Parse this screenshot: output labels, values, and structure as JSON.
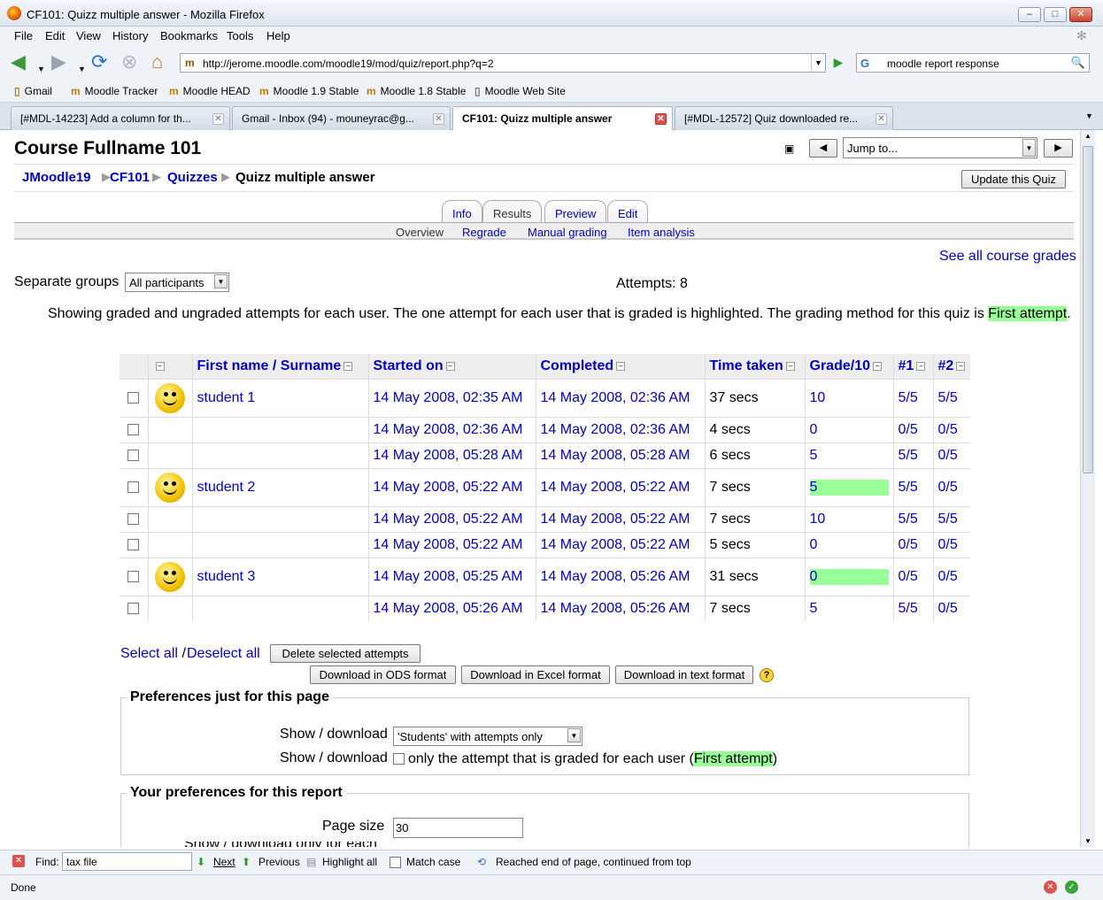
{
  "window": {
    "title": "CF101: Quizz multiple answer - Mozilla Firefox",
    "controls": [
      "minimize-icon",
      "maximize-icon",
      "close-icon"
    ]
  },
  "menu": [
    "File",
    "Edit",
    "View",
    "History",
    "Bookmarks",
    "Tools",
    "Help"
  ],
  "nav": {
    "url": "http://jerome.moodle.com/moodle19/mod/quiz/report.php?q=2",
    "search_value": "moodle report response"
  },
  "bookmarks": [
    "Gmail",
    "Moodle Tracker",
    "Moodle HEAD",
    "Moodle 1.9 Stable",
    "Moodle 1.8 Stable",
    "Moodle Web Site"
  ],
  "tabs": [
    {
      "label": "[#MDL-14223] Add a column for th..."
    },
    {
      "label": "Gmail - Inbox (94) - mouneyrac@g..."
    },
    {
      "label": "CF101: Quizz multiple answer"
    },
    {
      "label": "[#MDL-12572] Quiz downloaded re..."
    }
  ],
  "page": {
    "course_title": "Course Fullname 101",
    "jump_to": "Jump to...",
    "breadcrumb": [
      "JMoodle19",
      "CF101",
      "Quizzes",
      "Quizz multiple answer"
    ],
    "breadcrumb_sep": "▶",
    "update_button": "Update this Quiz",
    "quiz_tabs": [
      "Info",
      "Results",
      "Preview",
      "Edit"
    ],
    "sub_tabs": [
      "Overview",
      "Regrade",
      "Manual grading",
      "Item analysis"
    ],
    "see_all": "See all course grades",
    "groups_label": "Separate groups",
    "groups_value": "All participants",
    "attempts": "Attempts: 8",
    "info_text": "Showing graded and ungraded attempts for each user. The one attempt for each user that is graded is highlighted. The grading method for this quiz is",
    "info_method": "First attempt",
    "info_end": "."
  },
  "table": {
    "headers": {
      "name1": "First name",
      "slash": " / ",
      "name2": "Surname",
      "started": "Started on",
      "completed": "Completed",
      "time": "Time taken",
      "grade": "Grade/10",
      "q1": "#1",
      "q2": "#2"
    },
    "rows": [
      {
        "user": "student 1",
        "started": "14 May 2008, 02:35 AM",
        "completed": "14 May 2008, 02:36 AM",
        "time": "37 secs",
        "grade": "10",
        "q1": "5/5",
        "q2": "5/5",
        "highlight": false
      },
      {
        "user": "",
        "started": "14 May 2008, 02:36 AM",
        "completed": "14 May 2008, 02:36 AM",
        "time": "4 secs",
        "grade": "0",
        "q1": "0/5",
        "q2": "0/5",
        "highlight": false
      },
      {
        "user": "",
        "started": "14 May 2008, 05:28 AM",
        "completed": "14 May 2008, 05:28 AM",
        "time": "6 secs",
        "grade": "5",
        "q1": "5/5",
        "q2": "0/5",
        "highlight": false
      },
      {
        "user": "student 2",
        "started": "14 May 2008, 05:22 AM",
        "completed": "14 May 2008, 05:22 AM",
        "time": "7 secs",
        "grade": "5",
        "q1": "5/5",
        "q2": "0/5",
        "highlight": true
      },
      {
        "user": "",
        "started": "14 May 2008, 05:22 AM",
        "completed": "14 May 2008, 05:22 AM",
        "time": "7 secs",
        "grade": "10",
        "q1": "5/5",
        "q2": "5/5",
        "highlight": false
      },
      {
        "user": "",
        "started": "14 May 2008, 05:22 AM",
        "completed": "14 May 2008, 05:22 AM",
        "time": "5 secs",
        "grade": "0",
        "q1": "0/5",
        "q2": "0/5",
        "highlight": false
      },
      {
        "user": "student 3",
        "started": "14 May 2008, 05:25 AM",
        "completed": "14 May 2008, 05:26 AM",
        "time": "31 secs",
        "grade": "0",
        "q1": "0/5",
        "q2": "0/5",
        "highlight": true
      },
      {
        "user": "",
        "started": "14 May 2008, 05:26 AM",
        "completed": "14 May 2008, 05:26 AM",
        "time": "7 secs",
        "grade": "5",
        "q1": "5/5",
        "q2": "0/5",
        "highlight": false
      }
    ]
  },
  "actions": {
    "select_all": "Select all",
    "slash": " / ",
    "deselect_all": "Deselect all",
    "delete": "Delete selected attempts",
    "dl_ods": "Download in ODS format",
    "dl_excel": "Download in Excel format",
    "dl_text": "Download in text format",
    "help": "?"
  },
  "prefs_page": {
    "legend": "Preferences just for this page",
    "label1": "Show / download",
    "select1": "'Students' with attempts only",
    "label2": "Show / download",
    "check_text": "only the attempt that is graded for each user (",
    "check_method": "First attempt",
    "check_end": ")"
  },
  "prefs_report": {
    "legend": "Your preferences for this report",
    "page_size_label": "Page size",
    "page_size": "30",
    "cut_label": "Show / download only for each"
  },
  "find": {
    "label": "Find:",
    "value": "tax file",
    "next": "Next",
    "previous": "Previous",
    "highlight": "Highlight all",
    "match_case": "Match case",
    "status": "Reached end of page, continued from top"
  },
  "status": "Done"
}
